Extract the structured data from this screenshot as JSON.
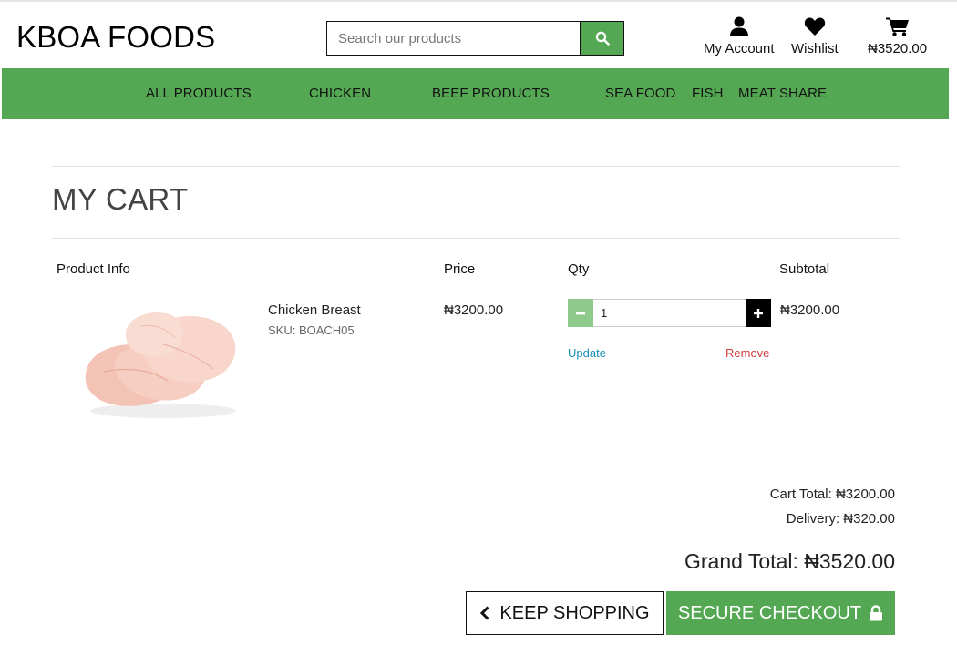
{
  "brand": {
    "logo_text": "KBOA FOODS",
    "accent": "#55a853"
  },
  "search": {
    "placeholder": "Search our products",
    "value": ""
  },
  "header_links": {
    "account_label": "My Account",
    "wishlist_label": "Wishlist",
    "cart_total": "₦3520.00"
  },
  "nav": {
    "items": [
      "ALL PRODUCTS",
      "CHICKEN",
      "BEEF PRODUCTS",
      "SEA FOOD",
      "FISH",
      "MEAT SHARE"
    ]
  },
  "page": {
    "title": "MY CART"
  },
  "table": {
    "headers": {
      "product": "Product Info",
      "price": "Price",
      "qty": "Qty",
      "subtotal": "Subtotal"
    }
  },
  "items": [
    {
      "name": "Chicken Breast",
      "sku": "SKU: BOACH05",
      "price": "₦3200.00",
      "qty": "1",
      "subtotal": "₦3200.00",
      "update_label": "Update",
      "remove_label": "Remove"
    }
  ],
  "totals": {
    "cart_total": "Cart Total: ₦3200.00",
    "delivery": "Delivery: ₦320.00",
    "grand_total": "Grand Total: ₦3520.00"
  },
  "buttons": {
    "keep_shopping": "KEEP SHOPPING",
    "secure_checkout": "SECURE CHECKOUT"
  },
  "colors": {
    "update_link": "#1a8fb5",
    "remove_link": "#d23a3a",
    "qty_minus": "#8dca8b"
  }
}
